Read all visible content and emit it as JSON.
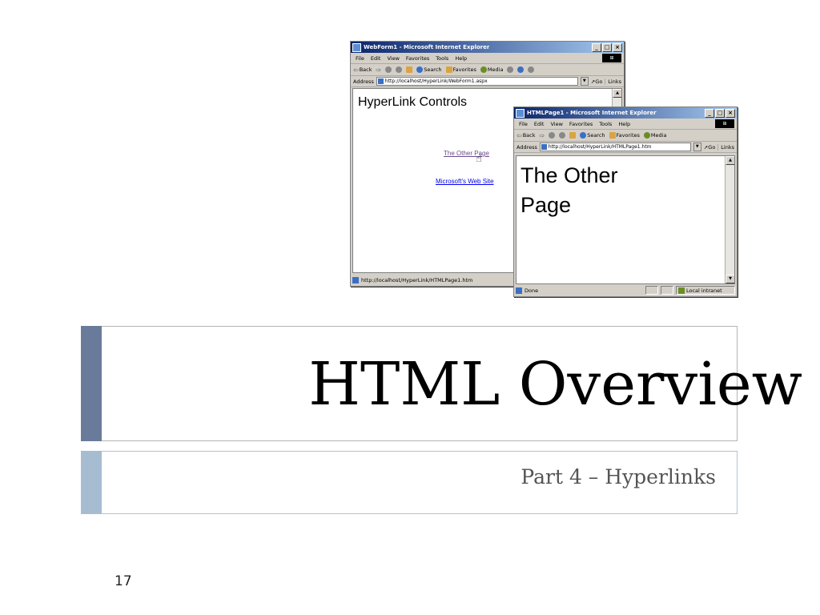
{
  "windows": {
    "webform": {
      "title": "WebForm1 - Microsoft Internet Explorer",
      "menu": [
        "File",
        "Edit",
        "View",
        "Favorites",
        "Tools",
        "Help"
      ],
      "toolbar": {
        "back": "Back",
        "search": "Search",
        "favorites": "Favorites",
        "media": "Media"
      },
      "address_label": "Address",
      "address_value": "http://localhost/HyperLink/WebForm1.aspx",
      "go_label": "Go",
      "links_label": "Links",
      "page": {
        "heading": "HyperLink Controls",
        "link1": "The Other Page",
        "link2": "Microsoft's Web Site"
      },
      "status_text": "http://localhost/HyperLink/HTMLPage1.htm"
    },
    "htmlpage": {
      "title": "HTMLPage1 - Microsoft Internet Explorer",
      "menu": [
        "File",
        "Edit",
        "View",
        "Favorites",
        "Tools",
        "Help"
      ],
      "toolbar": {
        "back": "Back",
        "search": "Search",
        "favorites": "Favorites",
        "media": "Media"
      },
      "address_label": "Address",
      "address_value": "http://localhost/HyperLink/HTMLPage1.htm",
      "go_label": "Go",
      "links_label": "Links",
      "page": {
        "heading": "The Other Page"
      },
      "status_text": "Done",
      "zone_text": "Local intranet"
    }
  },
  "slide": {
    "title": "HTML Overview",
    "subtitle": "Part 4 – Hyperlinks",
    "page_number": "17"
  },
  "colors": {
    "title_accent": "#6a7a9b",
    "subtitle_accent": "#a6bcd1",
    "titlebar_start": "#0a246a",
    "titlebar_end": "#a6caf0"
  }
}
